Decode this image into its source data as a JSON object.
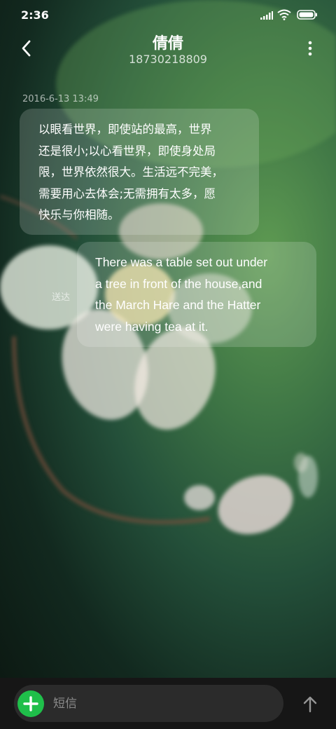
{
  "status_bar": {
    "time": "2:36",
    "icons": [
      "signal-icon",
      "wifi-icon",
      "battery-icon"
    ]
  },
  "header": {
    "contact_name": "倩倩",
    "contact_number": "18730218809",
    "back_icon": "chevron-left-icon",
    "more_icon": "more-vertical-icon"
  },
  "conversation": {
    "timestamp": "2016-6-13 13:49",
    "messages": [
      {
        "direction": "received",
        "lines": [
          "以眼看世界，即使站的最高，世界",
          "还是很小;以心看世界，即使身处局",
          "限，世界依然很大。生活远不完美，",
          "需要用心去体会;无需拥有太多，愿",
          "快乐与你相随。"
        ]
      },
      {
        "direction": "sent",
        "status": "送达",
        "lines": [
          "There was a table set out under",
          "a tree in front of the house,and",
          "the March Hare and the Hatter",
          "were having tea at it."
        ]
      }
    ]
  },
  "composer": {
    "placeholder": "短信",
    "value": "",
    "add_icon": "plus-icon",
    "send_icon": "arrow-up-icon",
    "add_button_color": "#1fbf4a"
  },
  "colors": {
    "background": "#24503a",
    "composer_bar": "#161616",
    "composer_field": "#2b2b2b",
    "bubble": "rgba(255,255,255,0.17)"
  }
}
